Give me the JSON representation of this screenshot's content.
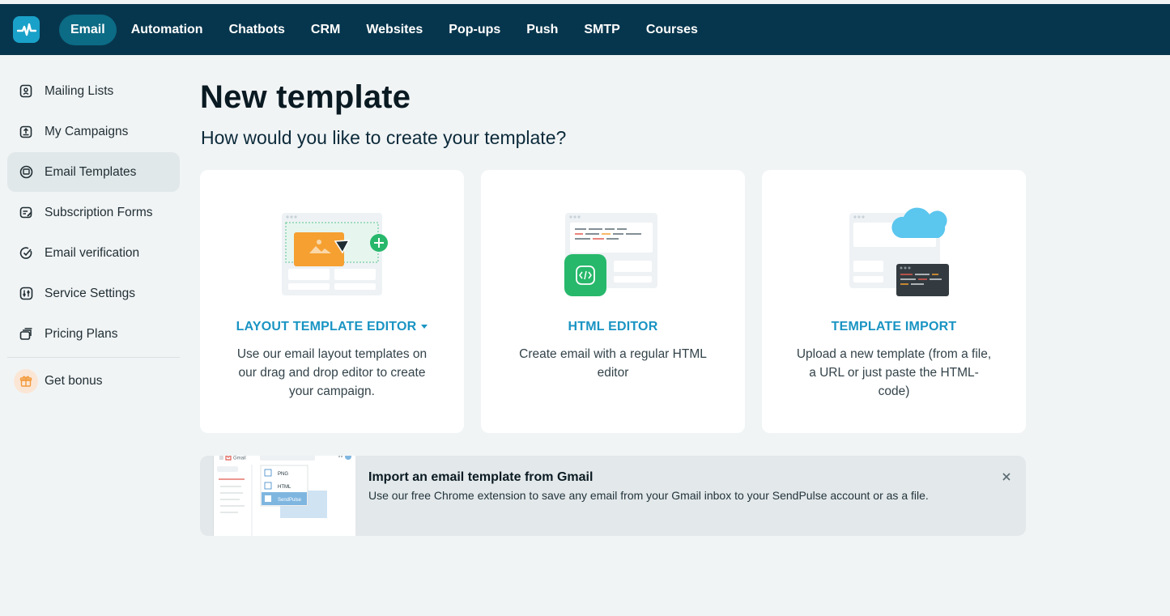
{
  "topnav": {
    "items": [
      {
        "label": "Email",
        "active": true
      },
      {
        "label": "Automation"
      },
      {
        "label": "Chatbots"
      },
      {
        "label": "CRM"
      },
      {
        "label": "Websites"
      },
      {
        "label": "Pop-ups"
      },
      {
        "label": "Push"
      },
      {
        "label": "SMTP"
      },
      {
        "label": "Courses"
      }
    ]
  },
  "sidebar": {
    "items": [
      {
        "label": "Mailing Lists",
        "icon": "contacts-book-icon"
      },
      {
        "label": "My Campaigns",
        "icon": "campaign-upload-icon"
      },
      {
        "label": "Email Templates",
        "icon": "template-icon",
        "active": true
      },
      {
        "label": "Subscription Forms",
        "icon": "form-edit-icon"
      },
      {
        "label": "Email verification",
        "icon": "check-circle-icon"
      },
      {
        "label": "Service Settings",
        "icon": "settings-sliders-icon"
      },
      {
        "label": "Pricing Plans",
        "icon": "stacked-cards-icon"
      }
    ],
    "bonus": {
      "label": "Get bonus",
      "icon": "gift-icon"
    }
  },
  "main": {
    "title": "New template",
    "subtitle": "How would you like to create your template?",
    "cards": [
      {
        "title": "LAYOUT TEMPLATE EDITOR",
        "desc": "Use our email layout templates on our drag and drop editor to create your campaign."
      },
      {
        "title": "HTML EDITOR",
        "desc": "Create email with a regular HTML editor"
      },
      {
        "title": "TEMPLATE IMPORT",
        "desc": "Upload a new template (from a file, a URL or just paste the HTML-code)"
      }
    ],
    "banner": {
      "title": "Import an email template from Gmail",
      "desc": "Use our free Chrome extension to save any email from your Gmail inbox to your SendPulse account or as a file.",
      "shot": {
        "app": "Gmail",
        "menu": [
          "PNG",
          "HTML",
          "SendPulse"
        ]
      }
    }
  },
  "colors": {
    "topbar": "#06364d",
    "accent": "#1a94c3",
    "active_tab": "#0c6b85"
  }
}
